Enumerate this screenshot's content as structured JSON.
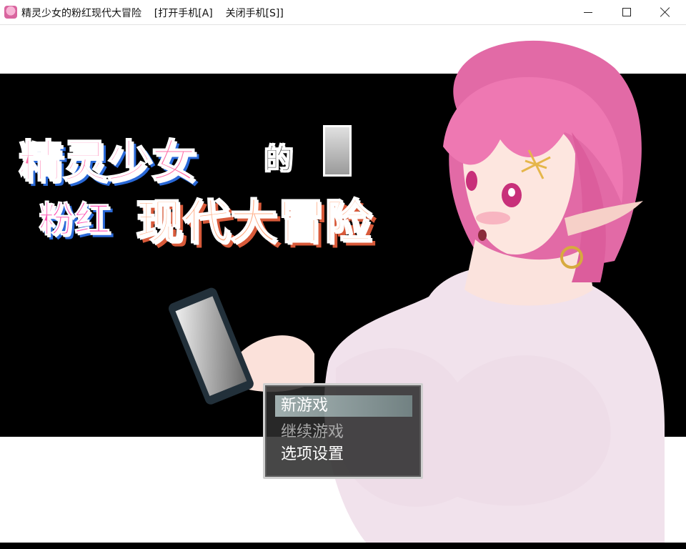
{
  "window": {
    "title": "精灵少女的粉红现代大冒险    [打开手机[A]    关闭手机[S]]",
    "icon": "game-app-icon",
    "controls": [
      "minimize",
      "maximize",
      "close"
    ]
  },
  "logo": {
    "line1": "精灵少女",
    "connector": "的",
    "line2_pink": "粉红",
    "line2_main": "现代大冒险"
  },
  "menu": {
    "items": [
      {
        "label": "新游戏",
        "state": "selected"
      },
      {
        "label": "继续游戏",
        "state": "disabled"
      },
      {
        "label": "选项设置",
        "state": "normal"
      }
    ]
  },
  "colors": {
    "background_band": "#000000",
    "logo_pink": "#ff6fa8",
    "logo_orange": "#ffb08a",
    "hair": "#e86aa8",
    "menu_bg": "#2d2d2d"
  }
}
